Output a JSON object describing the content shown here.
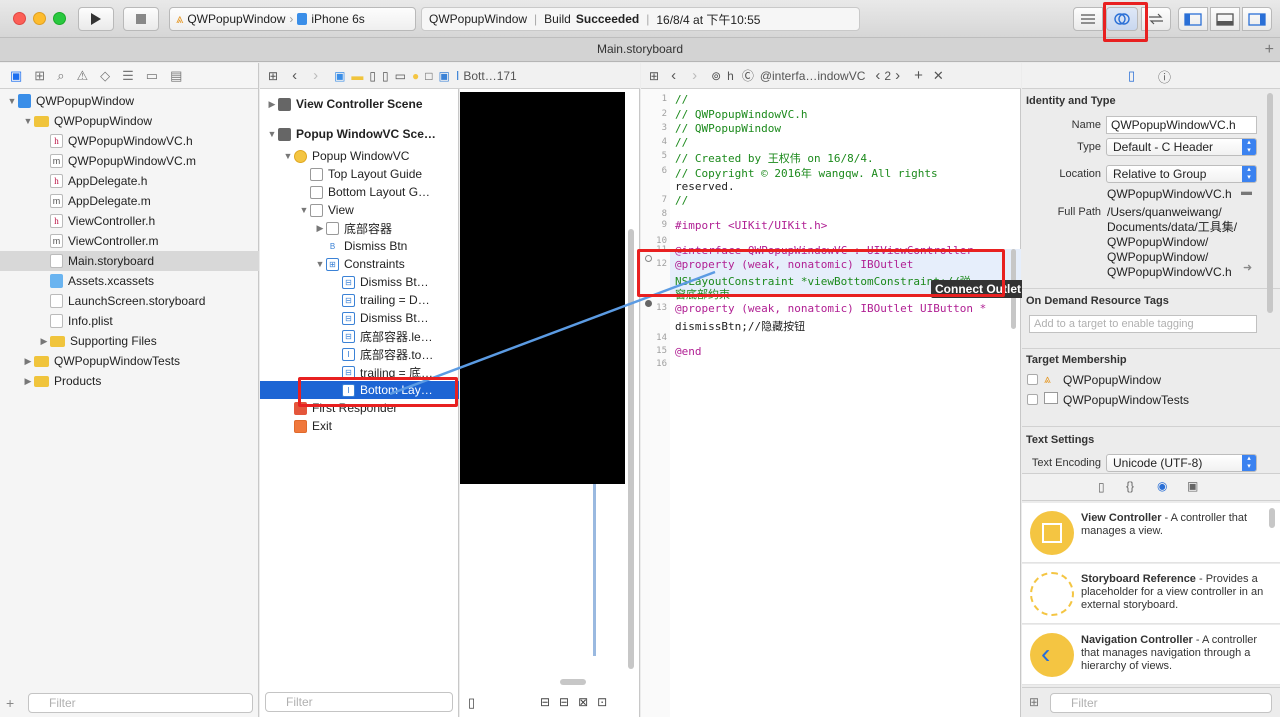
{
  "titlebar": {
    "scheme_name": "QWPopupWindow",
    "device": "iPhone 6s",
    "status_project": "QWPopupWindow",
    "status_build": "Build",
    "status_result": "Succeeded",
    "status_time": "16/8/4 at 下午10:55"
  },
  "tab": {
    "title": "Main.storyboard"
  },
  "navigator": {
    "items": [
      {
        "label": "QWPopupWindow",
        "kind": "project"
      },
      {
        "label": "QWPopupWindow",
        "kind": "folder"
      },
      {
        "label": "QWPopupWindowVC.h",
        "kind": "h"
      },
      {
        "label": "QWPopupWindowVC.m",
        "kind": "m"
      },
      {
        "label": "AppDelegate.h",
        "kind": "h"
      },
      {
        "label": "AppDelegate.m",
        "kind": "m"
      },
      {
        "label": "ViewController.h",
        "kind": "h"
      },
      {
        "label": "ViewController.m",
        "kind": "m"
      },
      {
        "label": "Main.storyboard",
        "kind": "storyboard"
      },
      {
        "label": "Assets.xcassets",
        "kind": "assets"
      },
      {
        "label": "LaunchScreen.storyboard",
        "kind": "storyboard"
      },
      {
        "label": "Info.plist",
        "kind": "plist"
      },
      {
        "label": "Supporting Files",
        "kind": "folder"
      },
      {
        "label": "QWPopupWindowTests",
        "kind": "folder"
      },
      {
        "label": "Products",
        "kind": "folder"
      }
    ],
    "filter_placeholder": "Filter"
  },
  "jumpbar_left": {
    "last": "Bott…171"
  },
  "jumpbar_right": {
    "item": "@interfa…indowVC",
    "counter": "2"
  },
  "outline": {
    "rows": [
      {
        "label": "View Controller Scene"
      },
      {
        "label": "Popup WindowVC Sce…"
      },
      {
        "label": "Popup WindowVC"
      },
      {
        "label": "Top Layout Guide"
      },
      {
        "label": "Bottom Layout G…"
      },
      {
        "label": "View"
      },
      {
        "label": "底部容器"
      },
      {
        "label": "Dismiss Btn"
      },
      {
        "label": "Constraints"
      },
      {
        "label": "Dismiss Bt…"
      },
      {
        "label": "trailing = D…"
      },
      {
        "label": "Dismiss Bt…"
      },
      {
        "label": "底部容器.le…"
      },
      {
        "label": "底部容器.to…"
      },
      {
        "label": "trailing = 底…"
      },
      {
        "label": "Bottom Lay…"
      },
      {
        "label": "First Responder"
      },
      {
        "label": "Exit"
      }
    ],
    "filter_placeholder": "Filter"
  },
  "code": {
    "lines": [
      {
        "n": "1",
        "t": "//"
      },
      {
        "n": "2",
        "t": "//  QWPopupWindowVC.h"
      },
      {
        "n": "3",
        "t": "//  QWPopupWindow"
      },
      {
        "n": "4",
        "t": "//"
      },
      {
        "n": "5",
        "t": "//  Created by 王权伟 on 16/8/4."
      },
      {
        "n": "6",
        "t": "//  Copyright © 2016年 wangqw. All rights"
      },
      {
        "n": "",
        "t": "    reserved."
      },
      {
        "n": "7",
        "t": "//"
      },
      {
        "n": "8",
        "t": ""
      },
      {
        "n": "9",
        "t": "#import <UIKit/UIKit.h>"
      },
      {
        "n": "10",
        "t": ""
      },
      {
        "n": "11",
        "t": "@interface QWPopupWindowVC : UIViewController"
      },
      {
        "n": "12",
        "t": "@property (weak, nonatomic) IBOutlet"
      },
      {
        "n": "",
        "t": "    NSLayoutConstraint *viewBottomConstraint;//弹"
      },
      {
        "n": "",
        "t": "    窗底部约束"
      },
      {
        "n": "13",
        "t": "@property (weak, nonatomic) IBOutlet UIButton *"
      },
      {
        "n": "",
        "t": "    dismissBtn;//隐藏按钮"
      },
      {
        "n": "14",
        "t": ""
      },
      {
        "n": "15",
        "t": "@end"
      },
      {
        "n": "16",
        "t": ""
      }
    ],
    "tooltip": "Connect Outlet"
  },
  "inspector": {
    "identity_title": "Identity and Type",
    "name_label": "Name",
    "name_value": "QWPopupWindowVC.h",
    "type_label": "Type",
    "type_value": "Default - C Header",
    "location_label": "Location",
    "location_value": "Relative to Group",
    "location_file": "QWPopupWindowVC.h",
    "fullpath_label": "Full Path",
    "fullpath_lines": [
      "/Users/quanweiwang/",
      "Documents/data/工具集/",
      "QWPopupWindow/",
      "QWPopupWindow/",
      "QWPopupWindowVC.h"
    ],
    "odr_title": "On Demand Resource Tags",
    "odr_placeholder": "Add to a target to enable tagging",
    "target_title": "Target Membership",
    "targets": [
      "QWPopupWindow",
      "QWPopupWindowTests"
    ],
    "text_title": "Text Settings",
    "encoding_label": "Text Encoding",
    "encoding_value": "Unicode (UTF-8)",
    "library": [
      {
        "name": "View Controller",
        "desc": " - A controller that manages a view."
      },
      {
        "name": "Storyboard Reference",
        "desc": " - Provides a placeholder for a view controller in an external storyboard."
      },
      {
        "name": "Navigation Controller",
        "desc": " - A controller that manages navigation through a hierarchy of views."
      }
    ],
    "filter_placeholder": "Filter"
  },
  "colors": {
    "highlight": "#e82020",
    "selection": "#1d65d4",
    "accent": "#3b82f0"
  }
}
